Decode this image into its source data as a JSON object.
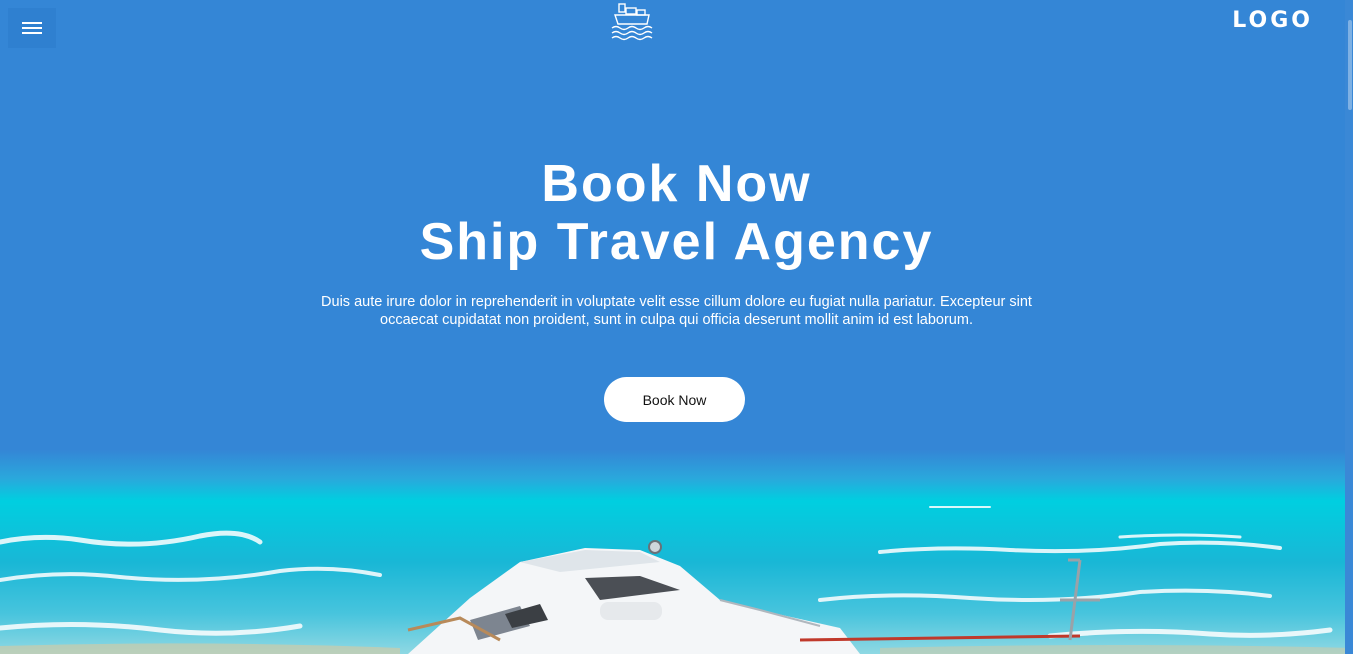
{
  "header": {
    "menu_icon": "hamburger-menu-icon",
    "brand_icon": "cargo-ship-icon",
    "logo_text": "LOGO"
  },
  "hero": {
    "title_line1": "Book Now",
    "title_line2": "Ship Travel Agency",
    "description": "Duis aute irure dolor in reprehenderit in voluptate velit esse cillum dolore eu fugiat nulla pariatur. Excepteur sint occaecat cupidatat non proident, sunt in culpa qui officia deserunt mollit anim id est laborum.",
    "cta_label": "Book Now",
    "image": "yacht-on-sea"
  },
  "colors": {
    "background": "#3486d6",
    "button_bg": "#ffffff",
    "text": "#ffffff",
    "sea_top": "#00c8dc",
    "sea_bottom": "#5fc6df"
  }
}
